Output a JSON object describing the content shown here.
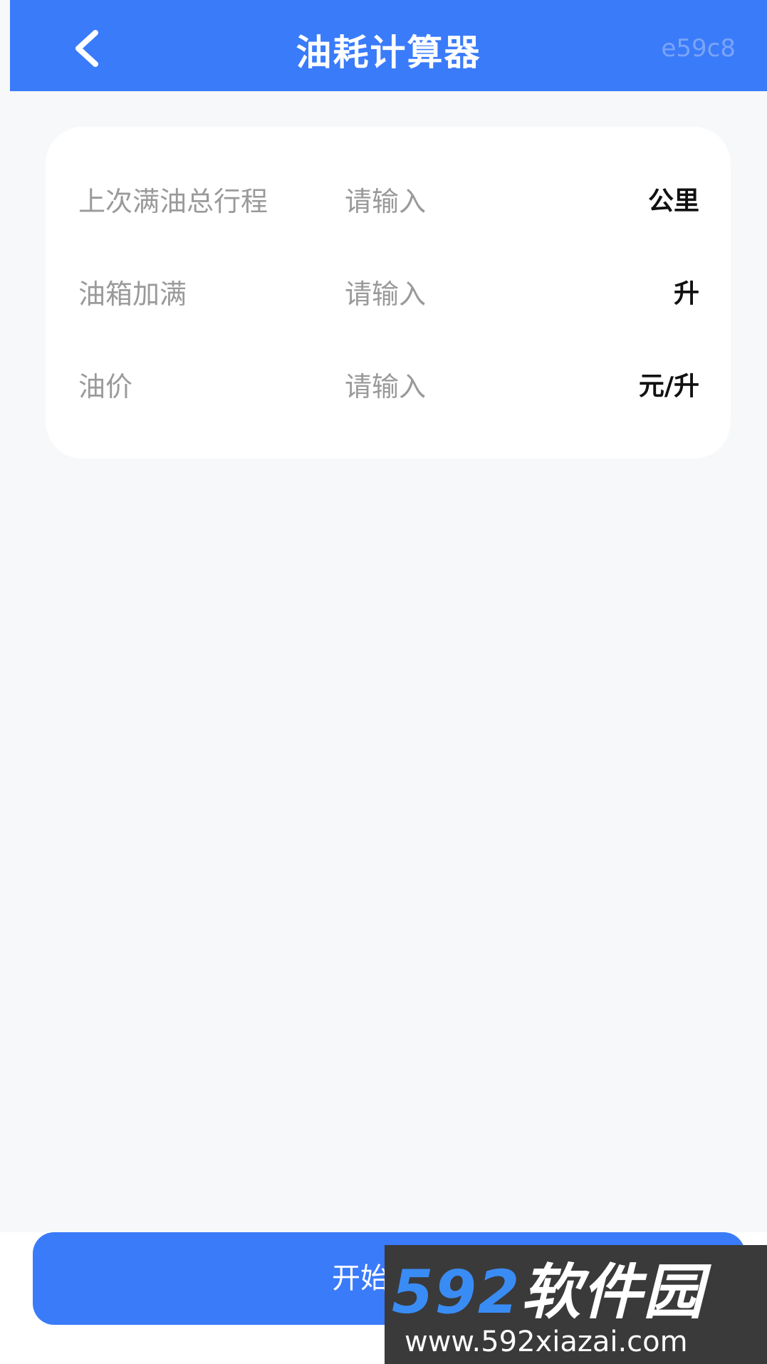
{
  "header": {
    "title": "油耗计算器",
    "code": "e59c8",
    "back_icon": "chevron-left-icon"
  },
  "form": {
    "rows": [
      {
        "label": "上次满油总行程",
        "placeholder": "请输入",
        "unit": "公里"
      },
      {
        "label": "油箱加满",
        "placeholder": "请输入",
        "unit": "升"
      },
      {
        "label": "油价",
        "placeholder": "请输入",
        "unit": "元/升"
      }
    ]
  },
  "footer": {
    "calculate_label": "开始计算"
  },
  "watermark": {
    "number": "592",
    "name": "软件园",
    "url": "www.592xiazai.com"
  },
  "colors": {
    "primary": "#3a7bfa",
    "background": "#f7f8fa",
    "card": "#ffffff",
    "label_gray": "#9a9a9a",
    "unit_text": "#111111"
  }
}
